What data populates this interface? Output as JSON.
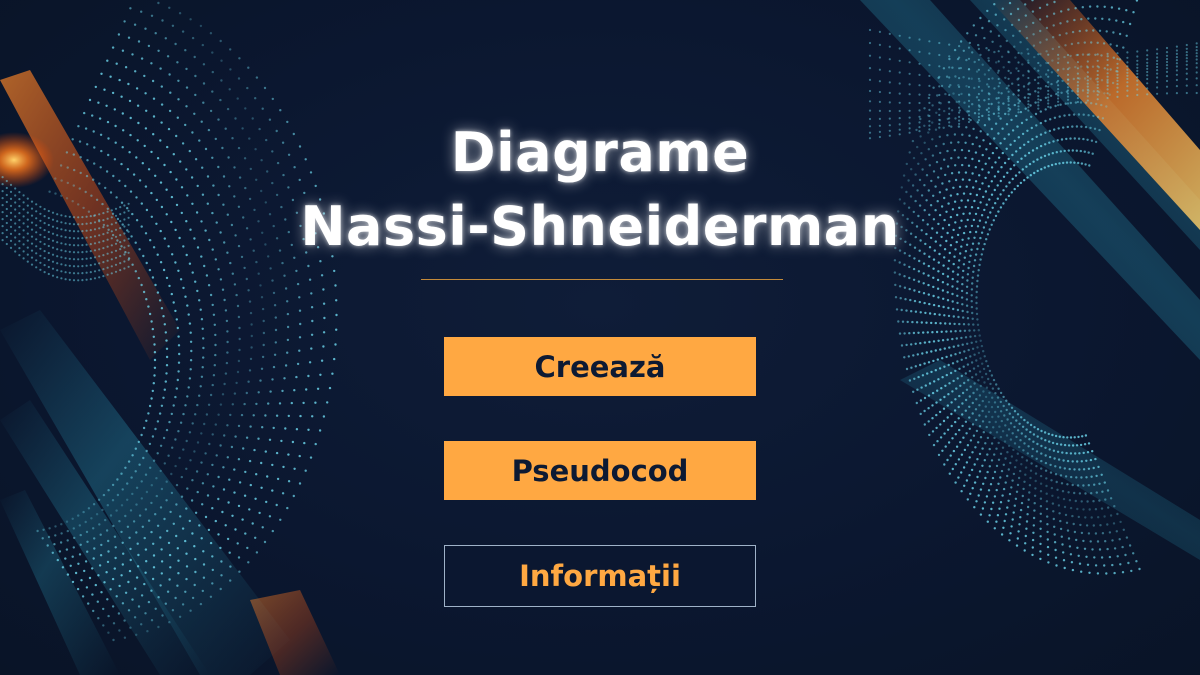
{
  "title": {
    "line1": "Diagrame",
    "line2": "Nassi-Shneiderman"
  },
  "menu": {
    "create_label": "Creează",
    "pseudocode_label": "Pseudocod",
    "info_label": "Informații"
  },
  "colors": {
    "background": "#0b1730",
    "accent": "#ffa842",
    "title_text": "#ffffff",
    "divider": "#c38a3a",
    "particle_cyan": "#59d6ee",
    "glow_orange": "#ff7a1a"
  }
}
